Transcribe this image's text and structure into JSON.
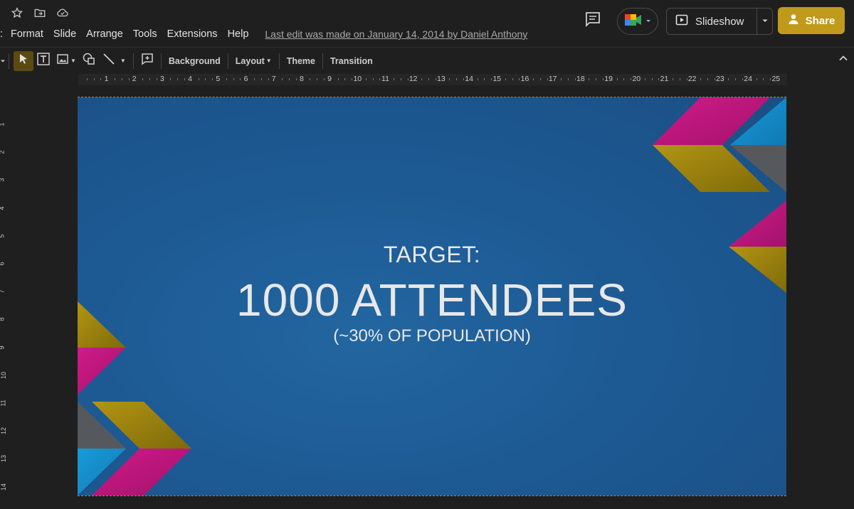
{
  "menu": {
    "items": [
      "Format",
      "Slide",
      "Arrange",
      "Tools",
      "Extensions",
      "Help"
    ],
    "last_edit": "Last edit was made on January 14, 2014 by Daniel Anthony"
  },
  "header": {
    "slideshow_label": "Slideshow",
    "share_label": "Share"
  },
  "toolbar": {
    "background_label": "Background",
    "layout_label": "Layout",
    "theme_label": "Theme",
    "transition_label": "Transition"
  },
  "ruler": {
    "h_numbers": [
      "1",
      "2",
      "3",
      "4",
      "5",
      "6",
      "7",
      "8",
      "9",
      "10",
      "11",
      "12",
      "13",
      "14",
      "15",
      "16",
      "17",
      "18",
      "19",
      "20",
      "21",
      "22",
      "23",
      "24",
      "25"
    ],
    "v_numbers": [
      "1",
      "2",
      "3",
      "4",
      "5",
      "6",
      "7",
      "8",
      "9",
      "10",
      "11",
      "12",
      "13",
      "14"
    ]
  },
  "slide": {
    "line1": "TARGET:",
    "line2": "1000 ATTENDEES",
    "line3": "(~30% OF POPULATION)"
  },
  "colors": {
    "share_button": "#c09a1b",
    "slide_background": "#1d5a94",
    "magenta": "#c4177f",
    "gold": "#a88c0c",
    "cyan": "#1592d2",
    "gray": "#55595e"
  },
  "icons": {
    "star": "star-icon",
    "move": "move-to-folder-icon",
    "cloud": "cloud-saved-icon",
    "comment": "comment-history-icon",
    "meet": "meet-icon",
    "play": "play-icon",
    "person": "person-add-icon"
  }
}
